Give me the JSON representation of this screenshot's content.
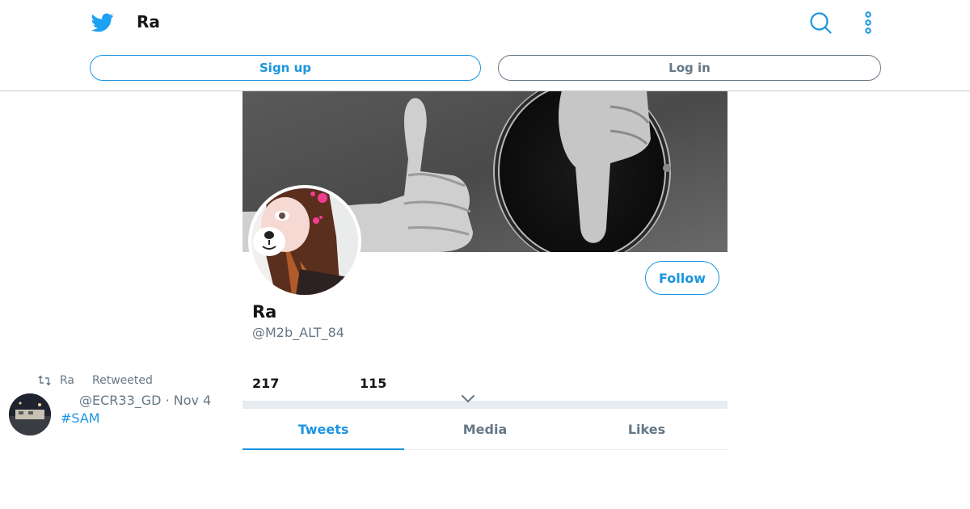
{
  "header": {
    "title": "Ra",
    "logo_icon": "twitter-bird-icon",
    "search_icon": "search-icon",
    "more_icon": "more-vertical-icon",
    "signup_label": "Sign up",
    "login_label": "Log in"
  },
  "profile": {
    "display_name": "Ra",
    "handle": "@M2b_ALT_84",
    "follow_label": "Follow",
    "following_count": "217",
    "followers_count": "115"
  },
  "tabs": [
    {
      "label": "Tweets",
      "active": true
    },
    {
      "label": "Media",
      "active": false
    },
    {
      "label": "Likes",
      "active": false
    }
  ],
  "tweet": {
    "retweet_icon": "retweet-icon",
    "retweeter": "Ra",
    "retweeted_label": "Retweeted",
    "meta": "@ECR33_GD · Nov 4",
    "text_preview": "#SAM",
    "menu_icon": "chevron-down-icon"
  },
  "colors": {
    "accent": "#1b95e0",
    "muted": "#657786",
    "text": "#14171a",
    "divider": "#e6ecf0"
  }
}
